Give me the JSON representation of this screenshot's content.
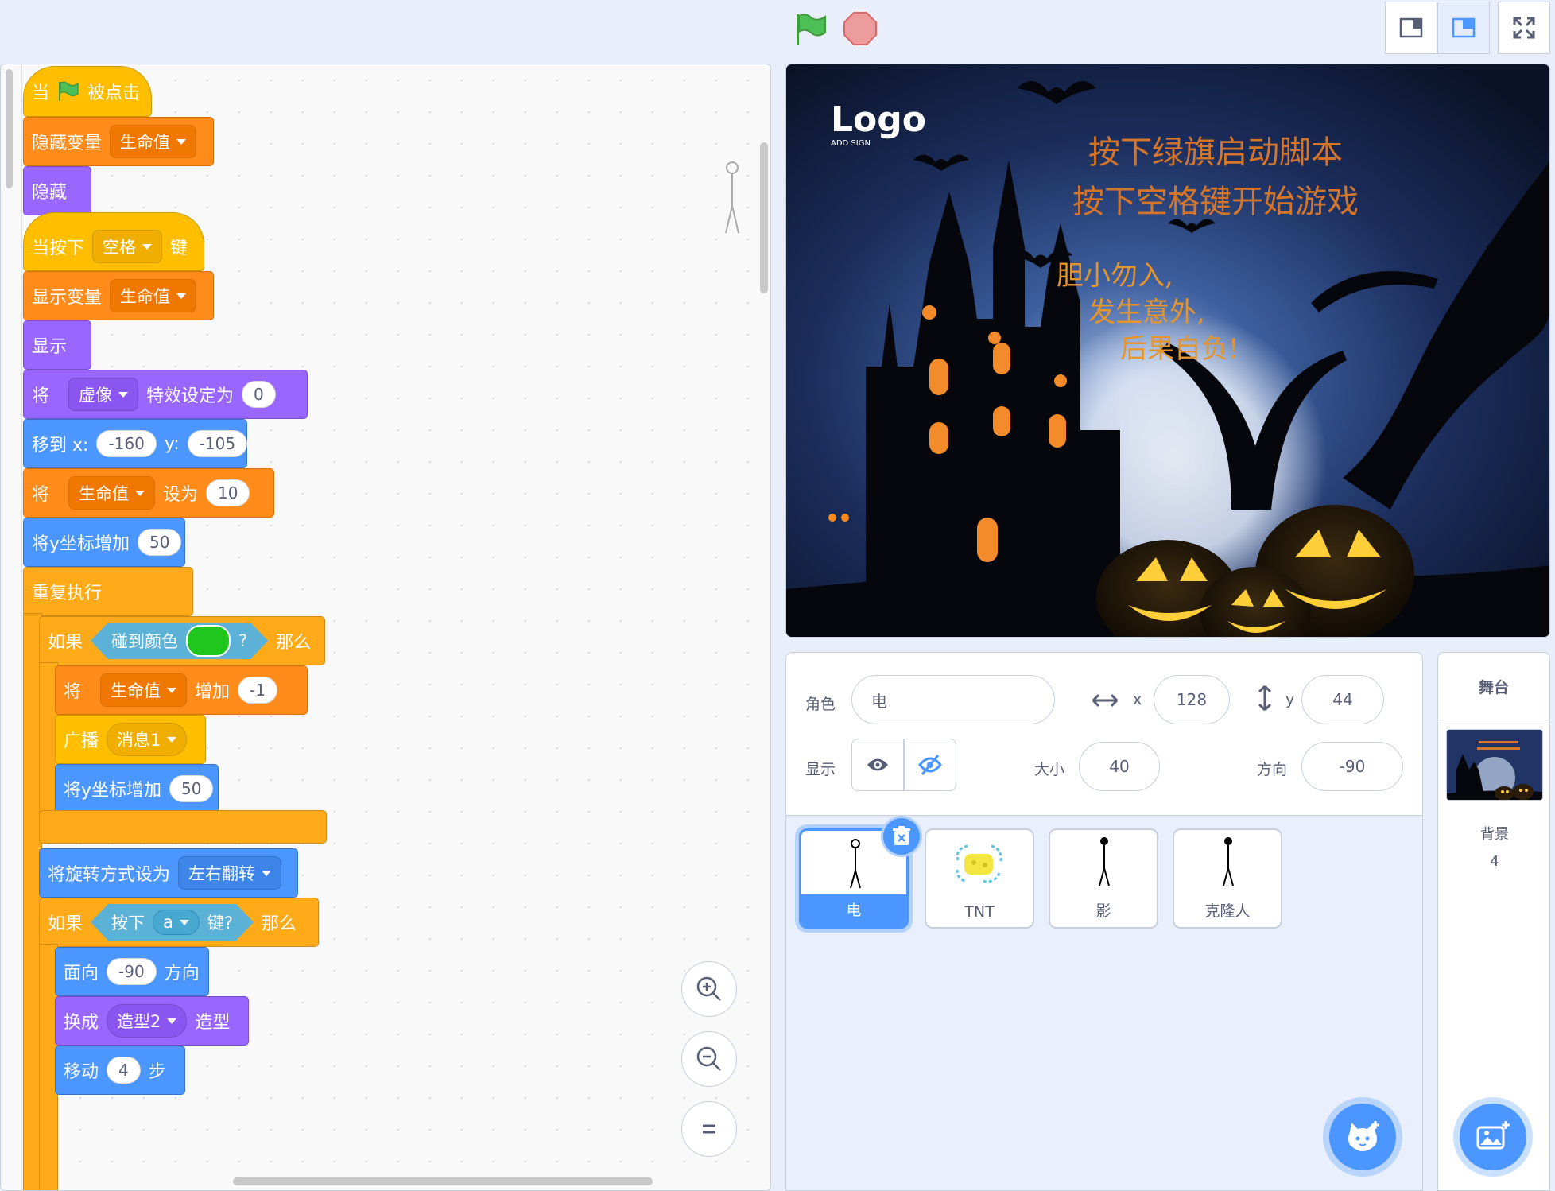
{
  "colors": {
    "events": "#ffbf00",
    "variables": "#ff8c1a",
    "looks": "#9966ff",
    "motion": "#4c97ff",
    "control": "#ffab19",
    "sensing": "#5cb1d6",
    "touch_color": "#1ec61e",
    "accent": "#4c97ff"
  },
  "toolbar": {
    "green_flag_icon": "green-flag-icon",
    "stop_icon": "stop-icon",
    "small_stage_icon": "small-stage-icon",
    "normal_stage_icon": "normal-stage-icon",
    "fullscreen_icon": "fullscreen-icon"
  },
  "scripts": {
    "s1": {
      "when": "当",
      "clicked": "被点击",
      "hide_var": "隐藏变量",
      "hide_var_name": "生命值",
      "hide": "隐藏"
    },
    "s2": {
      "when_press": "当按下",
      "key": "空格",
      "key_suffix": "键",
      "show_var": "显示变量",
      "show_var_name": "生命值",
      "show": "显示",
      "set_effect_pre": "将",
      "effect": "虚像",
      "set_effect_mid": "特效设定为",
      "effect_value": "0",
      "goto": "移到 x:",
      "goto_x": "-160",
      "goto_y_label": "y:",
      "goto_y": "-105",
      "set_var_pre": "将",
      "set_var_name": "生命值",
      "set_var_mid": "设为",
      "set_var_value": "10",
      "change_y": "将y坐标增加",
      "change_y_value": "50",
      "forever": "重复执行",
      "if1": "如果",
      "touch_color": "碰到颜色",
      "q": "?",
      "then1": "那么",
      "chg_var_pre": "将",
      "chg_var_name": "生命值",
      "chg_var_mid": "增加",
      "chg_var_value": "-1",
      "broadcast": "广播",
      "broadcast_msg": "消息1",
      "change_y2": "将y坐标增加",
      "change_y2_value": "50",
      "rot_style": "将旋转方式设为",
      "rot_value": "左右翻转",
      "if2": "如果",
      "press": "按下",
      "press_key": "a",
      "press_suffix": "键?",
      "then2": "那么",
      "point": "面向",
      "point_value": "-90",
      "point_suffix": "方向",
      "switch": "换成",
      "costume": "造型2",
      "switch_suffix": "造型",
      "move": "移动",
      "move_value": "4",
      "move_suffix": "步"
    }
  },
  "zoom": {
    "in_icon": "zoom-in-icon",
    "out_icon": "zoom-out-icon",
    "reset_icon": "zoom-reset-icon"
  },
  "stage": {
    "logo": "Logo",
    "logo_sub": "ADD SIGN",
    "line1": "按下绿旗启动脚本",
    "line2": "按下空格键开始游戏",
    "warn1": "胆小勿入,",
    "warn2": "发生意外,",
    "warn3": "后果自负!"
  },
  "sprite_info": {
    "sprite_label": "角色",
    "sprite_name": "电",
    "x_label": "x",
    "x_value": "128",
    "y_label": "y",
    "y_value": "44",
    "show_label": "显示",
    "size_label": "大小",
    "size_value": "40",
    "direction_label": "方向",
    "direction_value": "-90"
  },
  "sprites": [
    {
      "name": "电",
      "selected": true
    },
    {
      "name": "TNT",
      "selected": false
    },
    {
      "name": "影",
      "selected": false
    },
    {
      "name": "克隆人",
      "selected": false
    }
  ],
  "stage_pane": {
    "title": "舞台",
    "backdrops_label": "背景",
    "backdrops_count": "4"
  }
}
